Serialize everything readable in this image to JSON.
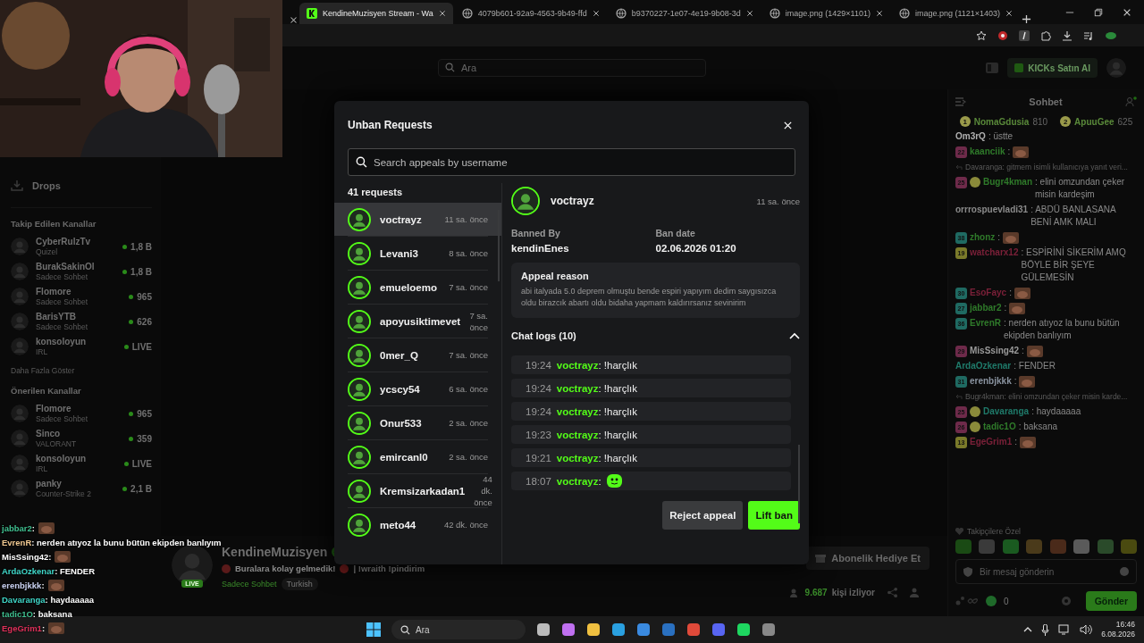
{
  "browser": {
    "tabs": [
      {
        "title": "KendineMuzisyen Stream - Wa",
        "selected": true
      },
      {
        "title": "4079b601-92a9-4563-9b49-ffd",
        "selected": false
      },
      {
        "title": "b9370227-1e07-4e19-9b08-3d",
        "selected": false
      },
      {
        "title": "image.png (1429×1101)",
        "selected": false
      },
      {
        "title": "image.png (1121×1403)",
        "selected": false
      }
    ]
  },
  "site_header": {
    "search": {
      "placeholder": "Ara"
    },
    "kicks_button": "KICKs Satın Al"
  },
  "sidebar": {
    "drops": "Drops",
    "followed": {
      "title": "Takip Edilen Kanallar",
      "channels": [
        {
          "name": "CyberRulzTv",
          "category": "Quizel",
          "viewers": "1,8 B"
        },
        {
          "name": "BurakSakinOl",
          "category": "Sadece Sohbet",
          "viewers": "1,8 B"
        },
        {
          "name": "Flomore",
          "category": "Sadece Sohbet",
          "viewers": "965"
        },
        {
          "name": "BarisYTB",
          "category": "Sadece Sohbet",
          "viewers": "626"
        },
        {
          "name": "konsoloyun",
          "category": "IRL",
          "viewers": "LIVE"
        }
      ]
    },
    "show_more": "Daha Fazla Göster",
    "recommended": {
      "title": "Önerilen Kanallar",
      "channels": [
        {
          "name": "Flomore",
          "category": "Sadece Sohbet",
          "viewers": "965"
        },
        {
          "name": "Sinco",
          "category": "VALORANT",
          "viewers": "359"
        },
        {
          "name": "konsoloyun",
          "category": "IRL",
          "viewers": "LIVE"
        },
        {
          "name": "panky",
          "category": "Counter-Strike 2",
          "viewers": "2,1 B"
        }
      ]
    }
  },
  "modal": {
    "title": "Unban Requests",
    "search": {
      "placeholder": "Search appeals by username"
    },
    "count": "41 requests",
    "requests": [
      {
        "username": "voctrayz",
        "time": "11 sa. önce",
        "selected": true
      },
      {
        "username": "Levani3",
        "time": "8 sa. önce",
        "selected": false
      },
      {
        "username": "emueloemo",
        "time": "7 sa. önce",
        "selected": false
      },
      {
        "username": "apoyusiktimevet",
        "time": "7 sa. önce",
        "selected": false
      },
      {
        "username": "0mer_Q",
        "time": "7 sa. önce",
        "selected": false
      },
      {
        "username": "ycscy54",
        "time": "6 sa. önce",
        "selected": false
      },
      {
        "username": "Onur533",
        "time": "2 sa. önce",
        "selected": false
      },
      {
        "username": "emircanl0",
        "time": "2 sa. önce",
        "selected": false
      },
      {
        "username": "Kremsizarkadan1",
        "time": "44 dk. önce",
        "selected": false
      },
      {
        "username": "meto44",
        "time": "42 dk. önce",
        "selected": false
      }
    ],
    "detail": {
      "username": "voctrayz",
      "time": "11 sa. önce",
      "banned_by_label": "Banned By",
      "banned_by": "kendinEnes",
      "ban_date_label": "Ban date",
      "ban_date": "02.06.2026 01:20",
      "appeal_title": "Appeal reason",
      "appeal_text": "abi italyada 5.0 deprem olmuştu bende espiri yapıyım dedim saygısızca oldu birazcık abartı oldu bidaha yapmam kaldırırsanız sevinirim",
      "logs_title": "Chat logs (10)",
      "logs_expanded": true,
      "logs": [
        {
          "kind": "text",
          "time": "19:24",
          "user": "voctrayz",
          "message": ": !harçlık"
        },
        {
          "kind": "text",
          "time": "19:24",
          "user": "voctrayz",
          "message": ": !harçlık"
        },
        {
          "kind": "text",
          "time": "19:24",
          "user": "voctrayz",
          "message": ": !harçlık"
        },
        {
          "kind": "text",
          "time": "19:23",
          "user": "voctrayz",
          "message": ": !harçlık"
        },
        {
          "kind": "text",
          "time": "19:21",
          "user": "voctrayz",
          "message": ": !harçlık"
        },
        {
          "kind": "emote",
          "time": "18:07",
          "user": "voctrayz",
          "message": ":"
        }
      ]
    },
    "reject": "Reject appeal",
    "lift": "Lift ban"
  },
  "stream_info": {
    "channel": "KendineMuzisyen",
    "live_badge": "LIVE",
    "title": "Buralara kolay gelmedik!",
    "commands": "| !wraith !pindirim",
    "category": "Sadece Sohbet",
    "tag": "Turkish",
    "gift_button": "Abonelik Hediye Et",
    "viewers": "9.687",
    "viewers_suffix": "kişi izliyor"
  },
  "chat": {
    "title": "Sohbet",
    "top_gifters": [
      {
        "rank": "1",
        "name": "NomaGdusia",
        "count": "810"
      },
      {
        "rank": "2",
        "name": "ApuuGee",
        "count": "625"
      }
    ],
    "messages": [
      {
        "kind": "message",
        "name": "Om3rQ",
        "color": "#b0b0b0",
        "text": ": üstte",
        "emote": false,
        "second_badge": false
      },
      {
        "kind": "message",
        "badge": {
          "text": "22",
          "color": "#6e2a4a"
        },
        "name": "kaanciik",
        "color": "#2f7a2a",
        "text": ":",
        "emote": true,
        "second_badge": false
      },
      {
        "kind": "reply",
        "text": "Davaranga: gitmem isimli kullanıcıya yanıt veri..."
      },
      {
        "kind": "message",
        "badge": {
          "text": "25",
          "color": "#6e2a4a"
        },
        "name": "Bugr4kman",
        "color": "#2f7a2a",
        "text": ": elini omzundan çeker misin kardeşim",
        "emote": false,
        "second_badge": true
      },
      {
        "kind": "message",
        "name": "orrrospuevladi31",
        "color": "#8a8a8a",
        "text": ": ABDÜ BANLASANA BENİ AMK MALI",
        "emote": false,
        "second_badge": false
      },
      {
        "kind": "message",
        "badge": {
          "text": "38",
          "color": "#1f6a62"
        },
        "name": "zhonz",
        "color": "#2f7a2a",
        "text": ":",
        "emote": true,
        "second_badge": false
      },
      {
        "kind": "message",
        "badge": {
          "text": "19",
          "color": "#7a7a2a"
        },
        "name": "watcharx12",
        "color": "#7a2038",
        "text": ": ESPİRİNİ SİKERİM AMQ BÖYLE BİR ŞEYE GÜLEMESİN",
        "emote": false,
        "second_badge": false
      },
      {
        "kind": "message",
        "badge": {
          "text": "30",
          "color": "#1f6a62"
        },
        "name": "EsoFayc",
        "color": "#7a2038",
        "text": ":",
        "emote": true,
        "second_badge": false
      },
      {
        "kind": "message",
        "badge": {
          "text": "27",
          "color": "#1f6a62"
        },
        "name": "jabbar2",
        "color": "#2f7a2a",
        "text": ":",
        "emote": true,
        "second_badge": false
      },
      {
        "kind": "message",
        "badge": {
          "text": "36",
          "color": "#1f6a62"
        },
        "name": "EvrenR",
        "color": "#2f7a2a",
        "text": ": nerden atıyoz la bunu bütün ekipden banlıyım",
        "emote": false,
        "second_badge": false
      },
      {
        "kind": "message",
        "badge": {
          "text": "29",
          "color": "#6e2a4a"
        },
        "name": "MisSsing42",
        "color": "#9a9a9a",
        "text": ":",
        "emote": true,
        "second_badge": false
      },
      {
        "kind": "message",
        "name": "ArdaOzkenar",
        "color": "#1f7a6a",
        "text": ": FENDER",
        "emote": false,
        "second_badge": false
      },
      {
        "kind": "message",
        "badge": {
          "text": "31",
          "color": "#1f6a62"
        },
        "name": "erenbjkkk",
        "color": "#8a93a0",
        "text": ":",
        "emote": true,
        "second_badge": false
      },
      {
        "kind": "reply",
        "text": "Bugr4kman: elini omzundan çeker misin karde..."
      },
      {
        "kind": "message",
        "badge": {
          "text": "25",
          "color": "#6e2a4a"
        },
        "name": "Davaranga",
        "color": "#1f7a6a",
        "text": ": haydaaaaa",
        "emote": false,
        "second_badge": true
      },
      {
        "kind": "message",
        "badge": {
          "text": "26",
          "color": "#6e2a4a"
        },
        "name": "tadic1O",
        "color": "#2f7a2a",
        "text": ": baksana",
        "emote": false,
        "second_badge": true
      },
      {
        "kind": "message",
        "badge": {
          "text": "13",
          "color": "#7a7a2a"
        },
        "name": "EgeGrim1",
        "color": "#7a2038",
        "text": ":",
        "emote": true,
        "second_badge": false
      }
    ],
    "followers_only": "Takipçilere Özel",
    "input": {
      "placeholder": "Bir mesaj gönderin"
    },
    "kicks_count": "0",
    "send_button": "Gönder"
  },
  "overlay_chat": [
    {
      "name": "jabbar2",
      "color": "#3fbf8f",
      "text": " :",
      "emote": true
    },
    {
      "name": "EvrenR",
      "color": "#f0c890",
      "text": " : nerden atıyoz la bunu bütün ekipden banlıyım",
      "emote": false
    },
    {
      "name": "MisSsing42",
      "color": "#ffffff",
      "text": " :",
      "emote": true
    },
    {
      "name": "ArdaOzkenar",
      "color": "#3fd6c8",
      "text": " : FENDER",
      "emote": false
    },
    {
      "name": "erenbjkkk",
      "color": "#c8d0f0",
      "text": " :",
      "emote": true
    },
    {
      "name": "Davaranga",
      "color": "#3fd6c8",
      "text": " : haydaaaaa",
      "emote": false
    },
    {
      "name": "tadic1O",
      "color": "#3fbf8f",
      "text": " : baksana",
      "emote": false
    },
    {
      "name": "EgeGrim1",
      "color": "#e0305a",
      "text": " :",
      "emote": true
    }
  ],
  "taskbar": {
    "search_placeholder": "Ara",
    "time": "16:46",
    "date": "6.08.2026"
  }
}
